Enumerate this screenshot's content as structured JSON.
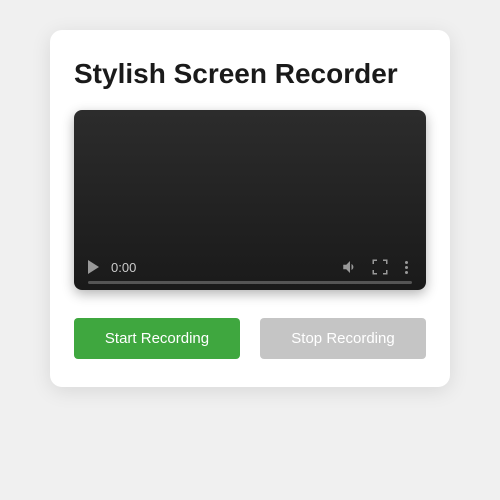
{
  "title": "Stylish Screen Recorder",
  "video": {
    "time": "0:00"
  },
  "buttons": {
    "start": "Start Recording",
    "stop": "Stop Recording"
  },
  "colors": {
    "start_bg": "#3fa73f",
    "stop_bg": "#c5c5c5"
  }
}
